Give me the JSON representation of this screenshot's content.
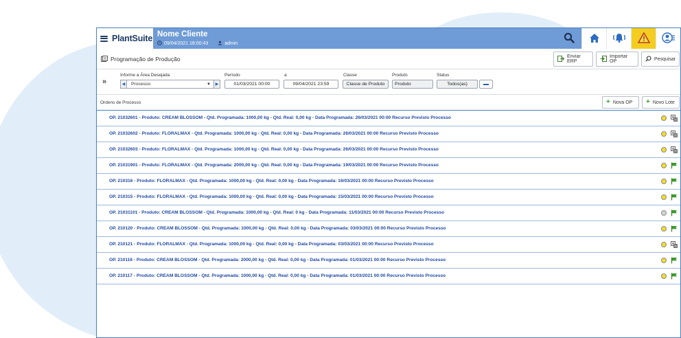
{
  "header": {
    "brand": "PlantSuite",
    "client_name": "Nome Cliente",
    "datetime": "09/04/2021 18:00:43",
    "user": "admin"
  },
  "page": {
    "title": "Programação de Produção",
    "actions": {
      "enviar_erp": "Enviar ERP",
      "importar_op": "Importar OP",
      "pesquisar": "Pesquisar"
    }
  },
  "filters": {
    "area_label": "Informe a Área Desejada",
    "area_value": "Processo",
    "periodo_label": "Período",
    "periodo_start": "01/03/2021 00:00",
    "a_label": "a",
    "periodo_end": "09/04/2021 23:59",
    "classe_label": "Classe",
    "classe_value": "Classe de Produto",
    "produto_label": "Produto",
    "produto_value": "Produto",
    "status_label": "Status",
    "status_value": "Todos(as)"
  },
  "orders": {
    "title": "Ordens de Processo",
    "nova_op": "Nova OP",
    "novo_lote": "Novo Lote",
    "rows": [
      {
        "text": "OP. 21032601 - Produto: CREAM BLOSSOM - Qtd. Programada: 1000,00 kg - Qtd. Real: 0,00 kg - Data Programada: 26/03/2021 00:00 Recurso Previsto Processo",
        "status": "yellow",
        "icon": "machine-icon"
      },
      {
        "text": "OP. 21032602 - Produto: FLORALMAX - Qtd. Programada: 1000,00 kg - Qtd. Real: 0,00 kg - Data Programada: 26/03/2021 00:00 Recurso Previsto Processo",
        "status": "yellow",
        "icon": "machine-icon"
      },
      {
        "text": "OP. 21032603 - Produto: FLORALMAX - Qtd. Programada: 1000,00 kg - Qtd. Real: 0,00 kg - Data Programada: 26/03/2021 00:00 Recurso Previsto Processo",
        "status": "yellow",
        "icon": "machine-icon"
      },
      {
        "text": "OP. 21031901 - Produto: FLORALMAX - Qtd. Programada: 2000,00 kg - Qtd. Real: 0,00 kg - Data Programada: 19/03/2021 00:00 Recurso Previsto Processo",
        "status": "yellow",
        "icon": "flag-icon"
      },
      {
        "text": "OP. 210316 - Produto: FLORALMAX - Qtd. Programada: 1000,00 kg - Qtd. Real: 0,00 kg - Data Programada: 16/03/2021 00:00 Recurso Previsto Processo",
        "status": "yellow",
        "icon": "flag-icon"
      },
      {
        "text": "OP. 210315 - Produto: FLORALMAX - Qtd. Programada: 1000,00 kg - Qtd. Real: 0,00 kg - Data Programada: 15/03/2021 00:00 Recurso Previsto Processo",
        "status": "yellow",
        "icon": "flag-icon"
      },
      {
        "text": "OP. 21031101 - Produto: CREAM BLOSSOM - Qtd. Programada: 1000,00 kg - Qtd. Real: 0 kg - Data Programada: 11/03/2021 00:00 Recurso Previsto Processo",
        "status": "grey",
        "icon": "flag-icon"
      },
      {
        "text": "OP. 210120 - Produto: CREAM BLOSSOM - Qtd. Programada: 1000,00 kg - Qtd. Real: 0,00 kg - Data Programada: 03/03/2021 00:00 Recurso Previsto Processo",
        "status": "yellow",
        "icon": "flag-icon"
      },
      {
        "text": "OP. 210121 - Produto: FLORALMAX - Qtd. Programada: 1000,00 kg - Qtd. Real: 0,00 kg - Data Programada: 03/03/2021 00:00 Recurso Previsto Processo",
        "status": "yellow",
        "icon": "machine-icon"
      },
      {
        "text": "OP. 210116 - Produto: CREAM BLOSSOM - Qtd. Programada: 2000,00 kg - Qtd. Real: 0,00 kg - Data Programada: 01/03/2021 00:00 Recurso Previsto Processo",
        "status": "yellow",
        "icon": "flag-icon"
      },
      {
        "text": "OP. 210117 - Produto: CREAM BLOSSOM - Qtd. Programada: 1000,00 kg - Qtd. Real: 0,00 kg - Data Programada: 01/03/2021 00:00 Recurso Previsto Processo",
        "status": "yellow",
        "icon": "flag-icon"
      }
    ]
  },
  "colors": {
    "header_blue": "#6f9bd6",
    "alert_yellow": "#f3cd1f",
    "row_text_blue": "#1f49a3",
    "status_yellow": "#f2dd2a",
    "status_grey": "#d4d4d4",
    "flag_green": "#3c9a2c"
  }
}
